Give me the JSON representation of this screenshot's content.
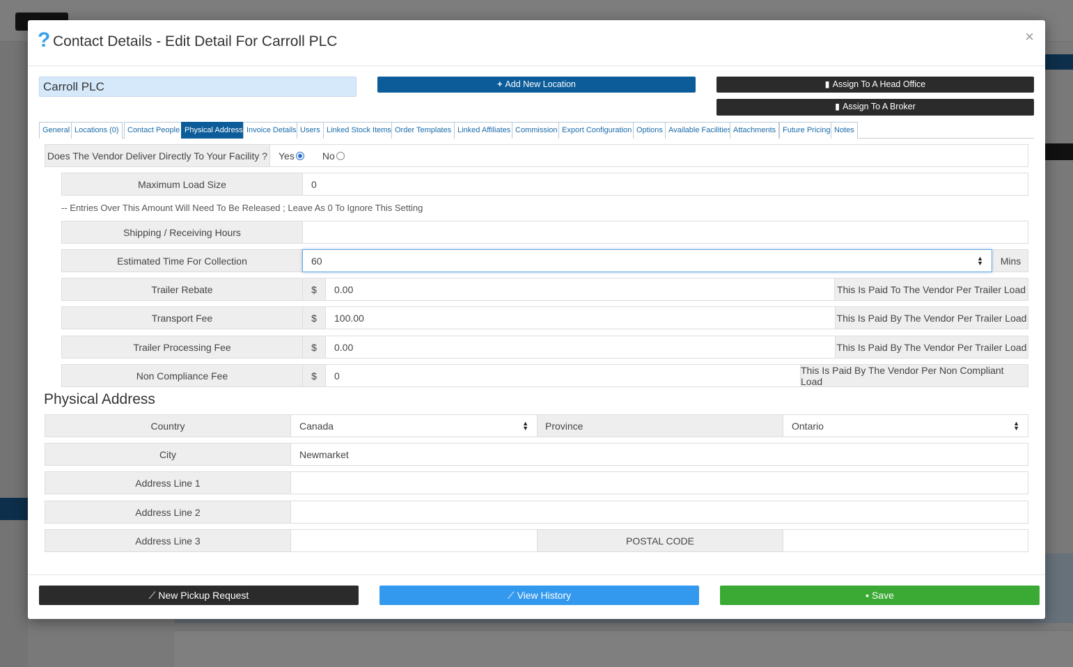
{
  "modal": {
    "help_icon": "?",
    "title": "Contact Details - Edit Detail For Carroll PLC",
    "close_icon": "×"
  },
  "header": {
    "name_value": "Carroll PLC",
    "add_location_label": "Add New Location",
    "assign_head_office_label": "Assign To A Head Office",
    "assign_broker_label": "Assign To A Broker"
  },
  "tabs": [
    {
      "label": "General",
      "active": false
    },
    {
      "label": "Locations (0)",
      "active": false
    },
    {
      "label": "Contact People",
      "active": false
    },
    {
      "label": "Physical Address",
      "active": true
    },
    {
      "label": "Invoice Details",
      "active": false
    },
    {
      "label": "Users",
      "active": false
    },
    {
      "label": "Linked Stock Items",
      "active": false
    },
    {
      "label": "Order Templates",
      "active": false
    },
    {
      "label": "Linked Affiliates",
      "active": false
    },
    {
      "label": "Commission",
      "active": false
    },
    {
      "label": "Export Configuration",
      "active": false
    },
    {
      "label": "Options",
      "active": false
    },
    {
      "label": "Available Facilities",
      "active": false
    },
    {
      "label": "Attachments",
      "active": false
    },
    {
      "label": "Future Pricing",
      "active": false
    },
    {
      "label": "Notes",
      "active": false
    }
  ],
  "delivery": {
    "question": "Does The Vendor Deliver Directly To Your Facility ?",
    "yes_label": "Yes",
    "no_label": "No",
    "selected": "Yes"
  },
  "fields": {
    "max_load_label": "Maximum Load Size",
    "max_load_value": "0",
    "max_load_note": "-- Entries Over This Amount Will Need To Be Released ; Leave As 0 To Ignore This Setting",
    "shipping_hours_label": "Shipping / Receiving Hours",
    "shipping_hours_value": "",
    "collection_label": "Estimated Time For Collection",
    "collection_value": "60",
    "collection_unit": "Mins",
    "currency_symbol": "$",
    "trailer_rebate_label": "Trailer Rebate",
    "trailer_rebate_value": "0.00",
    "trailer_rebate_note": "This Is Paid To The Vendor Per Trailer Load",
    "transport_fee_label": "Transport Fee",
    "transport_fee_value": "100.00",
    "transport_fee_note": "This Is Paid By The Vendor Per Trailer Load",
    "trailer_processing_label": "Trailer Processing Fee",
    "trailer_processing_value": "0.00",
    "trailer_processing_note": "This Is Paid By The Vendor Per Trailer Load",
    "non_compliance_label": "Non Compliance Fee",
    "non_compliance_value": "0",
    "non_compliance_note": "This Is Paid By The Vendor Per Non Compliant Load"
  },
  "address": {
    "section_title": "Physical Address",
    "country_label": "Country",
    "country_value": "Canada",
    "province_label": "Province",
    "province_value": "Ontario",
    "city_label": "City",
    "city_value": "Newmarket",
    "line1_label": "Address Line 1",
    "line1_value": "",
    "line2_label": "Address Line 2",
    "line2_value": "",
    "line3_label": "Address Line 3",
    "line3_value": "",
    "postal_label": "POSTAL CODE",
    "postal_value": ""
  },
  "footer": {
    "pickup_label": "New Pickup Request",
    "history_label": "View History",
    "save_label": "Save"
  },
  "colors": {
    "primary_dark": "#0b5c99",
    "dark_button": "#2b2b2b",
    "history_blue": "#3399ee",
    "save_green": "#3aaa35"
  }
}
